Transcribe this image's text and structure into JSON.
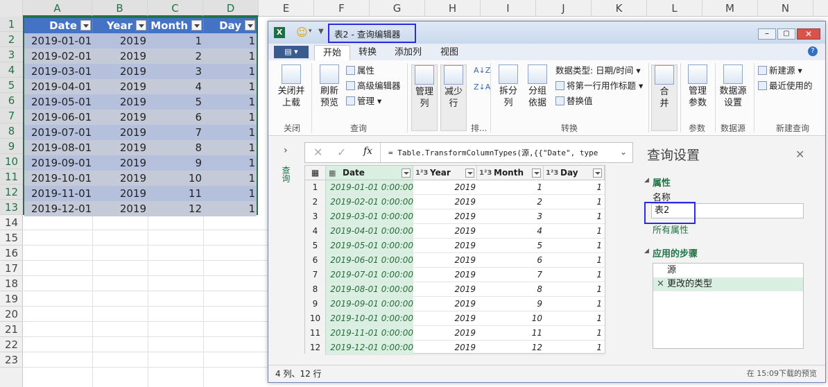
{
  "excel": {
    "columns": [
      "A",
      "B",
      "C",
      "D",
      "E",
      "F",
      "G",
      "H",
      "I",
      "J",
      "K",
      "L",
      "M",
      "N"
    ],
    "rows": [
      "1",
      "2",
      "3",
      "4",
      "5",
      "6",
      "7",
      "8",
      "9",
      "10",
      "11",
      "12",
      "13",
      "14",
      "15",
      "16",
      "17",
      "18",
      "19",
      "20",
      "21",
      "22",
      "23"
    ],
    "table": {
      "headers": [
        "Date",
        "Year",
        "Month",
        "Day"
      ],
      "rows": [
        [
          "2019-01-01",
          "2019",
          "1",
          "1"
        ],
        [
          "2019-02-01",
          "2019",
          "2",
          "1"
        ],
        [
          "2019-03-01",
          "2019",
          "3",
          "1"
        ],
        [
          "2019-04-01",
          "2019",
          "4",
          "1"
        ],
        [
          "2019-05-01",
          "2019",
          "5",
          "1"
        ],
        [
          "2019-06-01",
          "2019",
          "6",
          "1"
        ],
        [
          "2019-07-01",
          "2019",
          "7",
          "1"
        ],
        [
          "2019-08-01",
          "2019",
          "8",
          "1"
        ],
        [
          "2019-09-01",
          "2019",
          "9",
          "1"
        ],
        [
          "2019-10-01",
          "2019",
          "10",
          "1"
        ],
        [
          "2019-11-01",
          "2019",
          "11",
          "1"
        ],
        [
          "2019-12-01",
          "2019",
          "12",
          "1"
        ]
      ]
    }
  },
  "editor": {
    "title": "表2 - 查询编辑器",
    "tabs": [
      "开始",
      "转换",
      "添加列",
      "视图"
    ],
    "ribbon": {
      "close_load": "关闭并\n上载",
      "refresh_preview": "刷新\n预览",
      "properties": "属性",
      "advanced_editor": "高级编辑器",
      "manage": "管理",
      "manage_columns": "管理\n列",
      "reduce_rows": "减少\n行",
      "split_column": "拆分\n列",
      "group_by": "分组\n依据",
      "data_type": "数据类型: 日期/时间",
      "first_row_header": "将第一行用作标题",
      "replace_values": "替换值",
      "merge": "合\n并",
      "manage_params": "管理\n参数",
      "datasource_settings": "数据源\n设置",
      "new_source": "新建源",
      "recent_sources": "最近使用的",
      "groups": [
        "关闭",
        "查询",
        "排...",
        "转换",
        "参数",
        "数据源",
        "新建查询"
      ]
    },
    "formula": "= Table.TransformColumnTypes(源,{{\"Date\", type",
    "fx": "fx",
    "queries_label": "查询",
    "grid": {
      "headers": [
        "Date",
        "Year",
        "Month",
        "Day"
      ],
      "type_icons": [
        "▦",
        "1²3",
        "1²3",
        "1²3"
      ],
      "rows": [
        [
          "1",
          "2019-01-01 0:00:00",
          "2019",
          "1",
          "1"
        ],
        [
          "2",
          "2019-02-01 0:00:00",
          "2019",
          "2",
          "1"
        ],
        [
          "3",
          "2019-03-01 0:00:00",
          "2019",
          "3",
          "1"
        ],
        [
          "4",
          "2019-04-01 0:00:00",
          "2019",
          "4",
          "1"
        ],
        [
          "5",
          "2019-05-01 0:00:00",
          "2019",
          "5",
          "1"
        ],
        [
          "6",
          "2019-06-01 0:00:00",
          "2019",
          "6",
          "1"
        ],
        [
          "7",
          "2019-07-01 0:00:00",
          "2019",
          "7",
          "1"
        ],
        [
          "8",
          "2019-08-01 0:00:00",
          "2019",
          "8",
          "1"
        ],
        [
          "9",
          "2019-09-01 0:00:00",
          "2019",
          "9",
          "1"
        ],
        [
          "10",
          "2019-10-01 0:00:00",
          "2019",
          "10",
          "1"
        ],
        [
          "11",
          "2019-11-01 0:00:00",
          "2019",
          "11",
          "1"
        ],
        [
          "12",
          "2019-12-01 0:00:00",
          "2019",
          "12",
          "1"
        ]
      ]
    },
    "settings": {
      "title": "查询设置",
      "properties": "属性",
      "name_label": "名称",
      "name_value": "表2",
      "all_properties": "所有属性",
      "applied_steps": "应用的步骤",
      "steps": [
        "源",
        "更改的类型"
      ]
    },
    "status": {
      "left": "4 列、12 行",
      "right": "在 15:09下载的预览"
    }
  }
}
